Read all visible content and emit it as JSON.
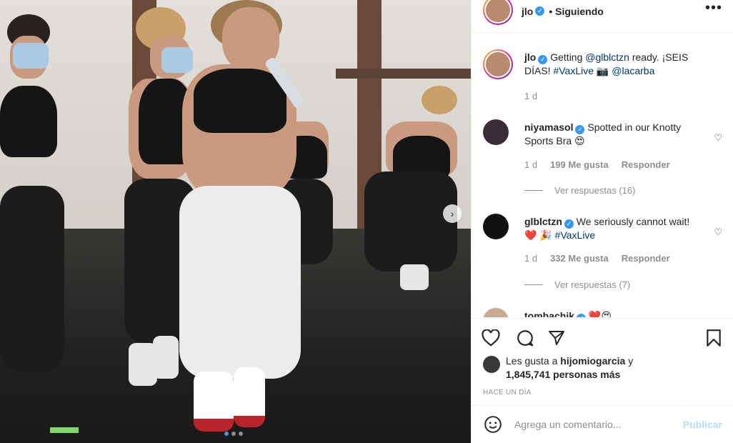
{
  "post": {
    "username": "jlo",
    "follow_status": "• Siguiendo",
    "more_label": "•••",
    "carousel_next_glyph": "›"
  },
  "caption": {
    "username": "jlo",
    "text_1": "Getting ",
    "mention_1": "@glblctzn",
    "text_2": " ready. ¡SEIS DÍAS! ",
    "hashtag": "#VaxLive",
    "emoji": "📷",
    "mention_2": "@lacarba",
    "age": "1 d"
  },
  "comments": [
    {
      "username": "niyamasol",
      "text": "Spotted in our Knotty Sports Bra 😍",
      "age": "1 d",
      "likes": "199 Me gusta",
      "reply_label": "Responder",
      "view_replies": "Ver respuestas (16)"
    },
    {
      "username": "glblctzn",
      "text_1": "We seriously cannot wait! ❤️ 🎉 ",
      "hashtag": "#VaxLive",
      "age": "1 d",
      "likes": "332 Me gusta",
      "reply_label": "Responder",
      "view_replies": "Ver respuestas (7)"
    },
    {
      "username": "tombachik",
      "text": "❤️😍"
    }
  ],
  "likes": {
    "prefix": "Les gusta a ",
    "user": "hijomiogarcia",
    "suffix": " y",
    "count": "1,845,741 personas más"
  },
  "timestamp": "HACE UN DÍA",
  "add_comment": {
    "placeholder": "Agrega un comentario...",
    "post_label": "Publicar"
  },
  "colors": {
    "verified": "#3897f0",
    "link": "#00376b",
    "publish_disabled": "#b2dffc"
  }
}
